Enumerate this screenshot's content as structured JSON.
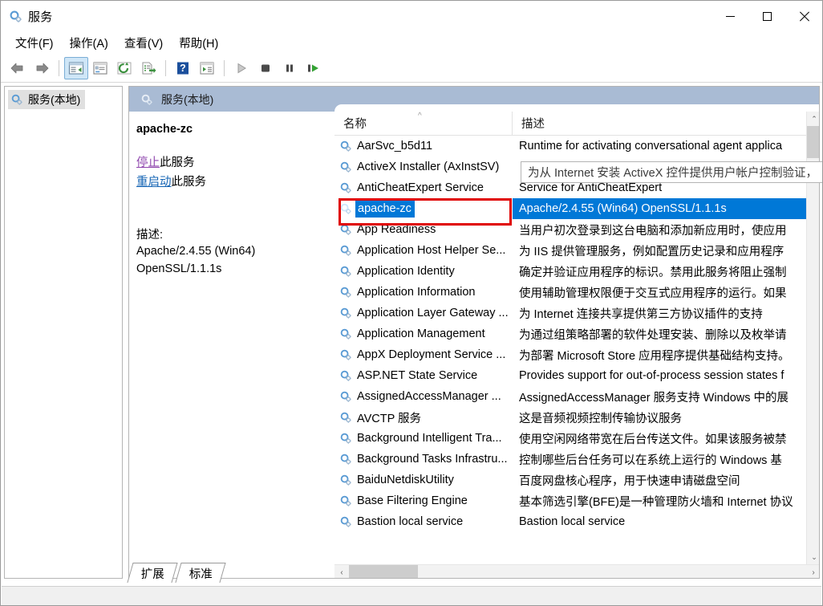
{
  "window": {
    "title": "服务",
    "icon": "services-gear-icon",
    "minimize_label": "最小化",
    "maximize_label": "最大化",
    "close_label": "关闭"
  },
  "menubar": {
    "items": [
      {
        "label": "文件(F)",
        "name": "menu-file"
      },
      {
        "label": "操作(A)",
        "name": "menu-action"
      },
      {
        "label": "查看(V)",
        "name": "menu-view"
      },
      {
        "label": "帮助(H)",
        "name": "menu-help"
      }
    ]
  },
  "toolbar": {
    "buttons": [
      {
        "icon": "back-arrow-icon",
        "name": "toolbar-back"
      },
      {
        "icon": "forward-arrow-icon",
        "name": "toolbar-forward"
      },
      {
        "icon": "show-hide-tree-icon",
        "name": "toolbar-show-hide-console-tree"
      },
      {
        "icon": "properties-icon",
        "name": "toolbar-properties"
      },
      {
        "icon": "refresh-icon",
        "name": "toolbar-refresh"
      },
      {
        "icon": "export-list-icon",
        "name": "toolbar-export-list"
      },
      {
        "icon": "help-icon",
        "name": "toolbar-help"
      },
      {
        "icon": "show-action-pane-icon",
        "name": "toolbar-show-action-pane"
      },
      {
        "icon": "start-service-icon",
        "name": "toolbar-start-service"
      },
      {
        "icon": "stop-service-icon",
        "name": "toolbar-stop-service"
      },
      {
        "icon": "pause-service-icon",
        "name": "toolbar-pause-service"
      },
      {
        "icon": "restart-service-icon",
        "name": "toolbar-restart-service"
      }
    ]
  },
  "tree": {
    "items": [
      {
        "label": "服务(本地)",
        "icon": "services-gear-icon",
        "selected": true
      }
    ]
  },
  "right_pane": {
    "header": {
      "title": "服务(本地)",
      "icon": "services-gear-icon"
    },
    "detail": {
      "service_name": "apache-zc",
      "link_stop": "停止",
      "link_stop_suffix": "此服务",
      "link_restart": "重启动",
      "link_restart_suffix": "此服务",
      "description_label": "描述:",
      "description_lines": [
        "Apache/2.4.55 (Win64)",
        "OpenSSL/1.1.1s"
      ]
    },
    "list": {
      "columns": [
        {
          "label": "名称",
          "name": "column-header-name",
          "sort": "asc"
        },
        {
          "label": "描述",
          "name": "column-header-description"
        }
      ],
      "sort_indicator": "^",
      "rows": [
        {
          "name": "AarSvc_b5d11",
          "description": "Runtime for activating conversational agent applica",
          "selected": false
        },
        {
          "name": "ActiveX Installer (AxInstSV)",
          "description": "",
          "selected": false
        },
        {
          "name": "AntiCheatExpert Service",
          "description": "Service for AntiCheatExpert",
          "selected": false
        },
        {
          "name": "apache-zc",
          "description": "Apache/2.4.55 (Win64) OpenSSL/1.1.1s",
          "selected": true
        },
        {
          "name": "App Readiness",
          "description": "当用户初次登录到这台电脑和添加新应用时，使应用",
          "selected": false
        },
        {
          "name": "Application Host Helper Se...",
          "description": "为 IIS 提供管理服务，例如配置历史记录和应用程序",
          "selected": false
        },
        {
          "name": "Application Identity",
          "description": "确定并验证应用程序的标识。禁用此服务将阻止强制",
          "selected": false
        },
        {
          "name": "Application Information",
          "description": "使用辅助管理权限便于交互式应用程序的运行。如果",
          "selected": false
        },
        {
          "name": "Application Layer Gateway ...",
          "description": "为 Internet 连接共享提供第三方协议插件的支持",
          "selected": false
        },
        {
          "name": "Application Management",
          "description": "为通过组策略部署的软件处理安装、删除以及枚举请",
          "selected": false
        },
        {
          "name": "AppX Deployment Service ...",
          "description": "为部署 Microsoft Store 应用程序提供基础结构支持。",
          "selected": false
        },
        {
          "name": "ASP.NET State Service",
          "description": "Provides support for out-of-process session states f",
          "selected": false
        },
        {
          "name": "AssignedAccessManager ...",
          "description": "AssignedAccessManager 服务支持 Windows 中的展",
          "selected": false
        },
        {
          "name": "AVCTP 服务",
          "description": "这是音频视频控制传输协议服务",
          "selected": false
        },
        {
          "name": "Background Intelligent Tra...",
          "description": "使用空闲网络带宽在后台传送文件。如果该服务被禁",
          "selected": false
        },
        {
          "name": "Background Tasks Infrastru...",
          "description": "控制哪些后台任务可以在系统上运行的 Windows 基",
          "selected": false
        },
        {
          "name": "BaiduNetdiskUtility",
          "description": "百度网盘核心程序，用于快速申请磁盘空间",
          "selected": false
        },
        {
          "name": "Base Filtering Engine",
          "description": "基本筛选引擎(BFE)是一种管理防火墙和 Internet 协议",
          "selected": false
        },
        {
          "name": "Bastion local service",
          "description": "Bastion local service",
          "selected": false
        }
      ],
      "tooltip": "为从 Internet 安装 ActiveX 控件提供用户帐户控制验证，",
      "vscroll_up": "⌃",
      "vscroll_down": "⌄",
      "hscroll_left": "‹",
      "hscroll_right": "›"
    }
  },
  "tabs": [
    {
      "label": "扩展",
      "name": "tab-extended",
      "active": false
    },
    {
      "label": "标准",
      "name": "tab-standard",
      "active": true
    }
  ],
  "colors": {
    "selection_blue": "#0078d7",
    "header_blue_gray": "#a9bbd4",
    "annotation_red": "#e00000",
    "link_visited": "#8e44ad",
    "link_normal": "#1464b4"
  }
}
